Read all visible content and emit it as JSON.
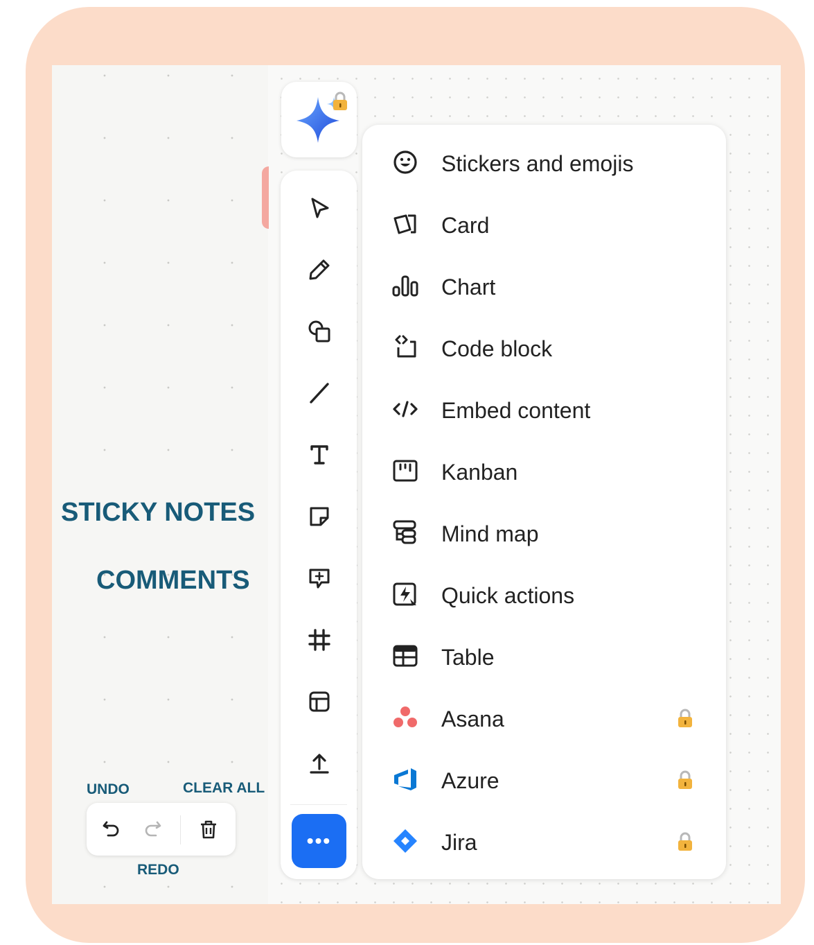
{
  "annotations": {
    "sticky_notes": "STICKY NOTES",
    "comments": "COMMENTS",
    "undo": "UNDO",
    "clear_all": "CLEAR ALL",
    "redo": "REDO"
  },
  "toolbar": {
    "more_label": "•••",
    "tools": [
      "select-icon",
      "pen-icon",
      "shapes-icon",
      "line-icon",
      "text-icon",
      "sticky-note-icon",
      "comment-icon",
      "frame-icon",
      "template-icon",
      "upload-icon"
    ]
  },
  "menu": {
    "items": [
      {
        "label": "Stickers and emojis",
        "icon": "smiley-icon",
        "locked": false
      },
      {
        "label": "Card",
        "icon": "card-icon",
        "locked": false
      },
      {
        "label": "Chart",
        "icon": "chart-icon",
        "locked": false
      },
      {
        "label": "Code block",
        "icon": "code-block-icon",
        "locked": false
      },
      {
        "label": "Embed content",
        "icon": "embed-icon",
        "locked": false
      },
      {
        "label": "Kanban",
        "icon": "kanban-icon",
        "locked": false
      },
      {
        "label": "Mind map",
        "icon": "mind-map-icon",
        "locked": false
      },
      {
        "label": "Quick actions",
        "icon": "quick-actions-icon",
        "locked": false
      },
      {
        "label": "Table",
        "icon": "table-icon",
        "locked": false
      },
      {
        "label": "Asana",
        "icon": "asana-icon",
        "locked": true
      },
      {
        "label": "Azure",
        "icon": "azure-icon",
        "locked": true
      },
      {
        "label": "Jira",
        "icon": "jira-icon",
        "locked": true
      }
    ]
  },
  "colors": {
    "frame": "#fcdcc9",
    "accent_blue": "#1b6ef3",
    "annotation_text": "#185b78",
    "asana": "#f06a6a",
    "azure": "#0a78d4",
    "jira": "#2684ff",
    "lock": "#f2b33d"
  }
}
